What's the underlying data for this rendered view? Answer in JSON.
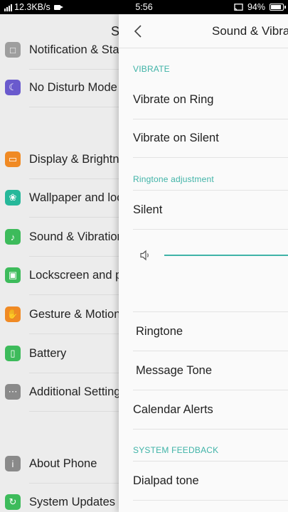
{
  "status_bar": {
    "net_speed": "12.3KB/s",
    "time": "5:56",
    "battery_pct": "94%",
    "battery_level": 0.94
  },
  "settings": {
    "title": "S",
    "items": [
      {
        "label": "Notification & Sta",
        "icon": "notification-icon",
        "color": "#9e9e9e"
      },
      {
        "label": "No Disturb Mode",
        "icon": "moon-icon",
        "color": "#6a5acd"
      },
      {
        "label": "Display & Brightn",
        "icon": "display-icon",
        "color": "#f08a24"
      },
      {
        "label": "Wallpaper and loc",
        "icon": "wallpaper-icon",
        "color": "#26b89a"
      },
      {
        "label": "Sound & Vibration",
        "icon": "speaker-icon",
        "color": "#3dbb5b"
      },
      {
        "label": "Lockscreen and p",
        "icon": "lock-icon",
        "color": "#3dbb5b"
      },
      {
        "label": "Gesture & Motion",
        "icon": "hand-icon",
        "color": "#f08a24"
      },
      {
        "label": "Battery",
        "icon": "battery-icon",
        "color": "#3dbb5b"
      },
      {
        "label": "Additional Setting",
        "icon": "more-icon",
        "color": "#8a8a8a"
      },
      {
        "label": "About Phone",
        "icon": "info-icon",
        "color": "#8a8a8a"
      },
      {
        "label": "System Updates",
        "icon": "update-icon",
        "color": "#3dbb5b"
      }
    ]
  },
  "sound_panel": {
    "title": "Sound & Vibra",
    "vibrate_header": "VIBRATE",
    "vibrate_on_ring": "Vibrate on Ring",
    "vibrate_on_silent": "Vibrate on Silent",
    "ringtone_header": "Ringtone adjustment",
    "silent": "Silent",
    "volume_level": 1.0,
    "ringtone": "Ringtone",
    "message_tone": "Message Tone",
    "calendar_alerts": "Calendar Alerts",
    "feedback_header": "SYSTEM FEEDBACK",
    "dialpad_tone": "Dialpad tone"
  },
  "accent_color": "#3fb3a7"
}
